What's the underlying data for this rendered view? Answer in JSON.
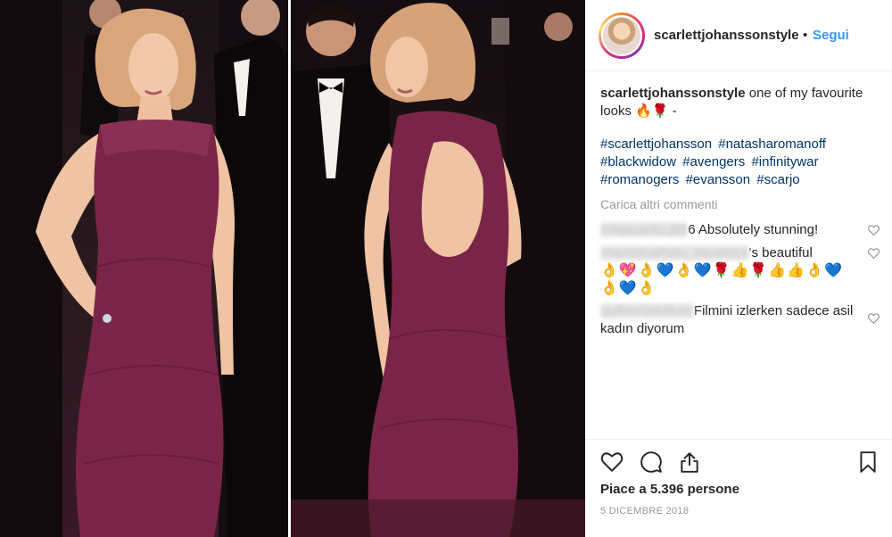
{
  "post": {
    "username": "scarlettjohanssonstyle",
    "separator": "•",
    "follow_label": "Segui",
    "caption_user": "scarlettjohanssonstyle",
    "caption_text": "one of my favourite looks 🔥🌹 -",
    "hashtags": [
      "#scarlettjohansson",
      "#natasharomanoff",
      "#blackwidow",
      "#avengers",
      "#infinitywar",
      "#romanogers",
      "#evansson",
      "#scarjo"
    ],
    "load_more_label": "Carica altri commenti",
    "comments": [
      {
        "user": "mlqaueritu.j96",
        "text": "6 Absolutely stunning!"
      },
      {
        "user": "marvelnathalu_daustrlcs",
        "text": "'s beautiful",
        "emojis_line1": "👌💖👌💙👌💙🌹👍🌹👍👍👌💙",
        "emojis_line2": "👌💙👌"
      },
      {
        "user": "gulfaerletkliban",
        "text": "Filmini izlerken sadece asil kadın diyorum"
      }
    ],
    "likes_label": "Piace a 5.396 persone",
    "date_label": "5 DICEMBRE 2018"
  },
  "icons": {
    "like": "heart-icon",
    "comment": "comment-icon",
    "share": "share-icon",
    "save": "bookmark-icon",
    "comment_like": "small-heart-icon"
  },
  "colors": {
    "accent": "#3897f0",
    "hashtag": "#003569",
    "muted": "#999999",
    "dress": "#7a2548"
  }
}
